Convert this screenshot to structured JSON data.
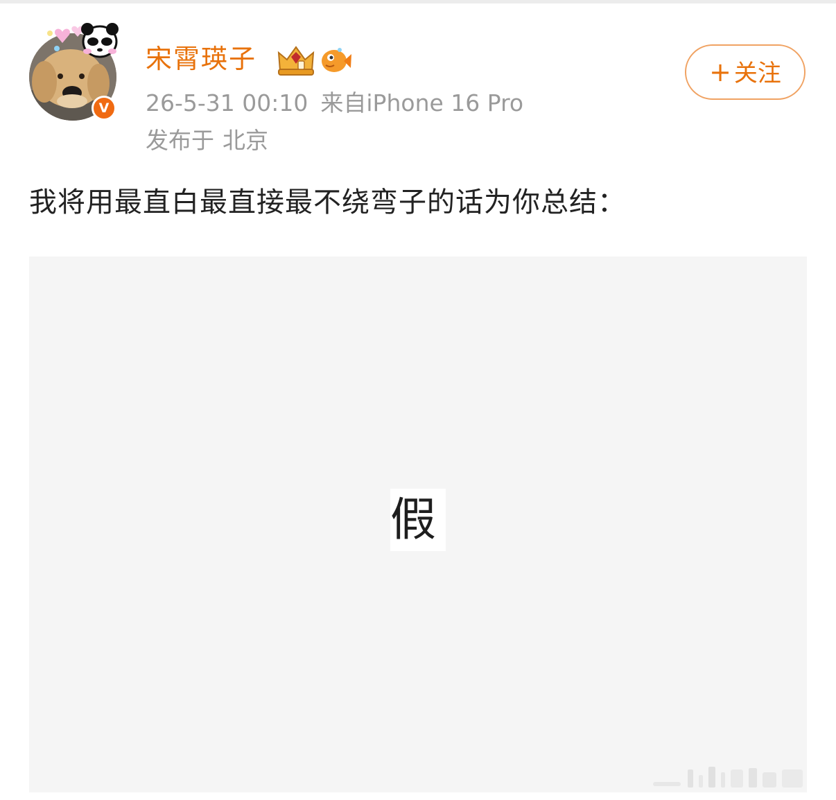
{
  "author": {
    "name": "宋霄瑛子",
    "verified_mark": "V",
    "avatar": "golden-retriever-photo",
    "badges": [
      "crown-badge-icon",
      "fish-badge-icon"
    ]
  },
  "meta": {
    "time": "26-5-31 00:10",
    "source": "来自iPhone 16 Pro",
    "location_label": "发布于",
    "location": "北京"
  },
  "follow_button": {
    "icon": "+",
    "label": "关注"
  },
  "post": {
    "text": "我将用最直白最直接最不绕弯子的话为你总结："
  },
  "image": {
    "text": "假"
  },
  "colors": {
    "accent": "#e8720b",
    "follow_border": "#f0a262",
    "meta_text": "#9a9a9a",
    "body_text": "#222222",
    "image_bg": "#f5f5f5",
    "verified": "#f06a12"
  }
}
